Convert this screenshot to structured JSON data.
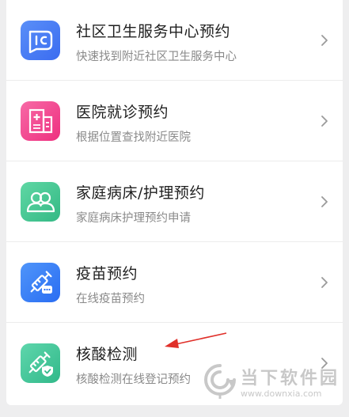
{
  "services": [
    {
      "title": "社区卫生服务中心预约",
      "subtitle": "快速找到附近社区卫生服务中心",
      "icon": "community-health-icon",
      "color": "#3d7df5"
    },
    {
      "title": "医院就诊预约",
      "subtitle": "根据位置查找附近医院",
      "icon": "hospital-icon",
      "color": "#f03e8a"
    },
    {
      "title": "家庭病床/护理预约",
      "subtitle": "家庭病床护理预约申请",
      "icon": "family-care-icon",
      "color": "#3fc58f"
    },
    {
      "title": "疫苗预约",
      "subtitle": "在线疫苗预约",
      "icon": "vaccine-icon",
      "color": "#2f7cf6"
    },
    {
      "title": "核酸检测",
      "subtitle": "核酸检测在线登记预约",
      "icon": "nucleic-test-icon",
      "color": "#3cc497"
    }
  ],
  "annotation": {
    "color": "#e0302a"
  },
  "watermark": {
    "text": "当下软件园",
    "url": "www.downxia.com"
  }
}
